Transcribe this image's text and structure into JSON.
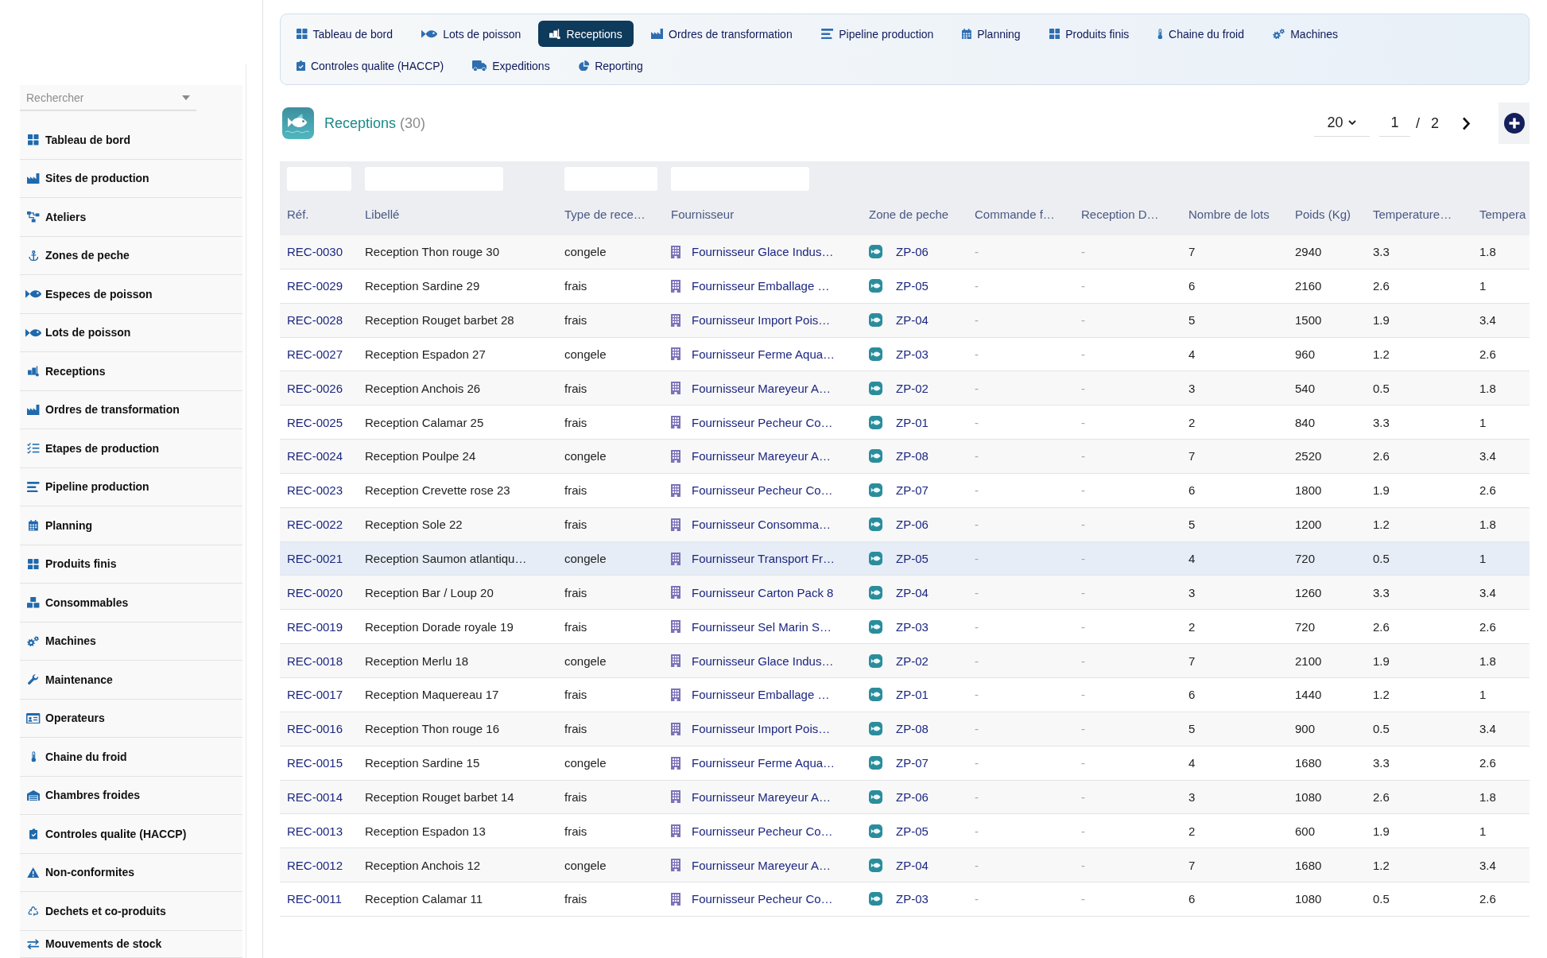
{
  "sidebar": {
    "search": {
      "placeholder": "Rechercher"
    },
    "items": [
      {
        "label": "Tableau de bord"
      },
      {
        "label": "Sites de production"
      },
      {
        "label": "Ateliers"
      },
      {
        "label": "Zones de peche"
      },
      {
        "label": "Especes de poisson"
      },
      {
        "label": "Lots de poisson"
      },
      {
        "label": "Receptions"
      },
      {
        "label": "Ordres de transformation"
      },
      {
        "label": "Etapes de production"
      },
      {
        "label": "Pipeline production"
      },
      {
        "label": "Planning"
      },
      {
        "label": "Produits finis"
      },
      {
        "label": "Consommables"
      },
      {
        "label": "Machines"
      },
      {
        "label": "Maintenance"
      },
      {
        "label": "Operateurs"
      },
      {
        "label": "Chaine du froid"
      },
      {
        "label": "Chambres froides"
      },
      {
        "label": "Controles qualite (HACCP)"
      },
      {
        "label": "Non-conformites"
      },
      {
        "label": "Dechets et co-produits"
      },
      {
        "label": "Mouvements de stock"
      }
    ]
  },
  "nav": {
    "tabs": [
      {
        "label": "Tableau de bord",
        "selected": false
      },
      {
        "label": "Lots de poisson",
        "selected": false
      },
      {
        "label": "Receptions",
        "selected": true
      },
      {
        "label": "Ordres de transformation",
        "selected": false
      },
      {
        "label": "Pipeline production",
        "selected": false
      },
      {
        "label": "Planning",
        "selected": false
      },
      {
        "label": "Produits finis",
        "selected": false
      },
      {
        "label": "Chaine du froid",
        "selected": false
      },
      {
        "label": "Machines",
        "selected": false
      },
      {
        "label": "Controles qualite (HACCP)",
        "selected": false
      },
      {
        "label": "Expeditions",
        "selected": false
      },
      {
        "label": "Reporting",
        "selected": false
      }
    ]
  },
  "header": {
    "title": "Receptions",
    "count": "(30)"
  },
  "pagination": {
    "page_size": "20",
    "page": "1",
    "separator": "/",
    "total_pages": "2"
  },
  "table": {
    "columns": [
      {
        "label": "Réf.",
        "kind": "link",
        "filterable": true
      },
      {
        "label": "Libellé",
        "kind": "text",
        "filterable": true
      },
      {
        "label": "Type de rece…",
        "kind": "text",
        "filterable": true
      },
      {
        "label": "Fournisseur",
        "kind": "supplier",
        "filterable": true
      },
      {
        "label": "Zone de peche",
        "kind": "zone",
        "filterable": false
      },
      {
        "label": "Commande f…",
        "kind": "muted",
        "filterable": false
      },
      {
        "label": "Reception D…",
        "kind": "muted",
        "filterable": false
      },
      {
        "label": "Nombre de lots",
        "kind": "text",
        "filterable": false
      },
      {
        "label": "Poids (Kg)",
        "kind": "text",
        "filterable": false
      },
      {
        "label": "Temperature…",
        "kind": "text",
        "filterable": false
      },
      {
        "label": "Tempera",
        "kind": "text",
        "filterable": false
      }
    ],
    "rows": [
      {
        "selected": false,
        "cells": [
          "REC-0030",
          "Reception Thon rouge 30",
          "congele",
          "Fournisseur Glace Indus…",
          "ZP-06",
          "-",
          "-",
          "7",
          "2940",
          "3.3",
          "1.8"
        ]
      },
      {
        "selected": false,
        "cells": [
          "REC-0029",
          "Reception Sardine 29",
          "frais",
          "Fournisseur Emballage …",
          "ZP-05",
          "-",
          "-",
          "6",
          "2160",
          "2.6",
          "1"
        ]
      },
      {
        "selected": false,
        "cells": [
          "REC-0028",
          "Reception Rouget barbet 28",
          "frais",
          "Fournisseur Import Pois…",
          "ZP-04",
          "-",
          "-",
          "5",
          "1500",
          "1.9",
          "3.4"
        ]
      },
      {
        "selected": false,
        "cells": [
          "REC-0027",
          "Reception Espadon 27",
          "congele",
          "Fournisseur Ferme Aqua…",
          "ZP-03",
          "-",
          "-",
          "4",
          "960",
          "1.2",
          "2.6"
        ]
      },
      {
        "selected": false,
        "cells": [
          "REC-0026",
          "Reception Anchois 26",
          "frais",
          "Fournisseur Mareyeur A…",
          "ZP-02",
          "-",
          "-",
          "3",
          "540",
          "0.5",
          "1.8"
        ]
      },
      {
        "selected": false,
        "cells": [
          "REC-0025",
          "Reception Calamar 25",
          "frais",
          "Fournisseur Pecheur Co…",
          "ZP-01",
          "-",
          "-",
          "2",
          "840",
          "3.3",
          "1"
        ]
      },
      {
        "selected": false,
        "cells": [
          "REC-0024",
          "Reception Poulpe 24",
          "congele",
          "Fournisseur Mareyeur A…",
          "ZP-08",
          "-",
          "-",
          "7",
          "2520",
          "2.6",
          "3.4"
        ]
      },
      {
        "selected": false,
        "cells": [
          "REC-0023",
          "Reception Crevette rose 23",
          "frais",
          "Fournisseur Pecheur Co…",
          "ZP-07",
          "-",
          "-",
          "6",
          "1800",
          "1.9",
          "2.6"
        ]
      },
      {
        "selected": false,
        "cells": [
          "REC-0022",
          "Reception Sole 22",
          "frais",
          "Fournisseur Consomma…",
          "ZP-06",
          "-",
          "-",
          "5",
          "1200",
          "1.2",
          "1.8"
        ]
      },
      {
        "selected": true,
        "cells": [
          "REC-0021",
          "Reception Saumon atlantiqu…",
          "congele",
          "Fournisseur Transport Fr…",
          "ZP-05",
          "-",
          "-",
          "4",
          "720",
          "0.5",
          "1"
        ]
      },
      {
        "selected": false,
        "cells": [
          "REC-0020",
          "Reception Bar / Loup 20",
          "frais",
          "Fournisseur Carton Pack 8",
          "ZP-04",
          "-",
          "-",
          "3",
          "1260",
          "3.3",
          "3.4"
        ]
      },
      {
        "selected": false,
        "cells": [
          "REC-0019",
          "Reception Dorade royale 19",
          "frais",
          "Fournisseur Sel Marin S…",
          "ZP-03",
          "-",
          "-",
          "2",
          "720",
          "2.6",
          "2.6"
        ]
      },
      {
        "selected": false,
        "cells": [
          "REC-0018",
          "Reception Merlu 18",
          "congele",
          "Fournisseur Glace Indus…",
          "ZP-02",
          "-",
          "-",
          "7",
          "2100",
          "1.9",
          "1.8"
        ]
      },
      {
        "selected": false,
        "cells": [
          "REC-0017",
          "Reception Maquereau 17",
          "frais",
          "Fournisseur Emballage …",
          "ZP-01",
          "-",
          "-",
          "6",
          "1440",
          "1.2",
          "1"
        ]
      },
      {
        "selected": false,
        "cells": [
          "REC-0016",
          "Reception Thon rouge 16",
          "frais",
          "Fournisseur Import Pois…",
          "ZP-08",
          "-",
          "-",
          "5",
          "900",
          "0.5",
          "3.4"
        ]
      },
      {
        "selected": false,
        "cells": [
          "REC-0015",
          "Reception Sardine 15",
          "congele",
          "Fournisseur Ferme Aqua…",
          "ZP-07",
          "-",
          "-",
          "4",
          "1680",
          "3.3",
          "2.6"
        ]
      },
      {
        "selected": false,
        "cells": [
          "REC-0014",
          "Reception Rouget barbet 14",
          "frais",
          "Fournisseur Mareyeur A…",
          "ZP-06",
          "-",
          "-",
          "3",
          "1080",
          "2.6",
          "1.8"
        ]
      },
      {
        "selected": false,
        "cells": [
          "REC-0013",
          "Reception Espadon 13",
          "frais",
          "Fournisseur Pecheur Co…",
          "ZP-05",
          "-",
          "-",
          "2",
          "600",
          "1.9",
          "1"
        ]
      },
      {
        "selected": false,
        "cells": [
          "REC-0012",
          "Reception Anchois 12",
          "congele",
          "Fournisseur Mareyeur A…",
          "ZP-04",
          "-",
          "-",
          "7",
          "1680",
          "1.2",
          "3.4"
        ]
      },
      {
        "selected": false,
        "cells": [
          "REC-0011",
          "Reception Calamar 11",
          "frais",
          "Fournisseur Pecheur Co…",
          "ZP-03",
          "-",
          "-",
          "6",
          "1080",
          "0.5",
          "2.6"
        ]
      }
    ]
  }
}
